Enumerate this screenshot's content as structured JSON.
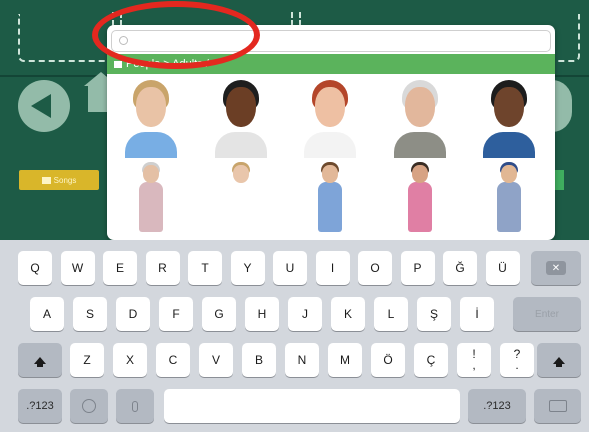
{
  "search": {
    "placeholder": "",
    "value": ""
  },
  "breadcrumb": "People > Adults /",
  "sidebar_button": {
    "label": "Songs"
  },
  "gallery": {
    "images": [
      {
        "name": "woman-blonde",
        "hair": "#c9a46a",
        "skin": "#e9c3a6",
        "shirt": "#78aee4"
      },
      {
        "name": "man-sunglasses",
        "hair": "#1e1e1e",
        "skin": "#6b3e25",
        "shirt": "#e4e4e4"
      },
      {
        "name": "woman-surprised",
        "hair": "#b4462a",
        "skin": "#eec0a3",
        "shirt": "#f3f3f3"
      },
      {
        "name": "elderly-man-suit",
        "hair": "#d9d9d9",
        "skin": "#e2b79c",
        "shirt": "#8d8e86"
      },
      {
        "name": "man-smiling",
        "hair": "#1d1d1d",
        "skin": "#6e442c",
        "shirt": "#2e5f9d"
      },
      {
        "name": "elderly-woman-seated",
        "hair": "#cfcfcf",
        "skin": "#e4c0a5",
        "shirt": "#d9b8be"
      },
      {
        "name": "woman-sitting",
        "hair": "#c8a46b",
        "skin": "#e9c6ab",
        "shirt": "#ffffff"
      },
      {
        "name": "woman-with-baby",
        "hair": "#6d4a2d",
        "skin": "#e2b898",
        "shirt": "#7ea4d8"
      },
      {
        "name": "woman-pink-dress",
        "hair": "#3a2d24",
        "skin": "#d7a384",
        "shirt": "#e07fa4"
      },
      {
        "name": "police-officer",
        "hair": "#2f4d8a",
        "skin": "#e1b794",
        "shirt": "#8fa3c7"
      }
    ]
  },
  "keyboard": {
    "row1": [
      "Q",
      "W",
      "E",
      "R",
      "T",
      "Y",
      "U",
      "I",
      "O",
      "P",
      "Ğ",
      "Ü"
    ],
    "row2": [
      "A",
      "S",
      "D",
      "F",
      "G",
      "H",
      "J",
      "K",
      "L",
      "Ş",
      "İ"
    ],
    "row3": [
      "Z",
      "X",
      "C",
      "V",
      "B",
      "N",
      "M",
      "Ö",
      "Ç",
      "!",
      ",",
      "?",
      "."
    ],
    "row3_keys": [
      "Z",
      "X",
      "C",
      "V",
      "B",
      "N",
      "M",
      "Ö",
      "Ç",
      "!\n,",
      "?\n."
    ],
    "numbers_label": ".?123",
    "return_label": "Enter"
  }
}
